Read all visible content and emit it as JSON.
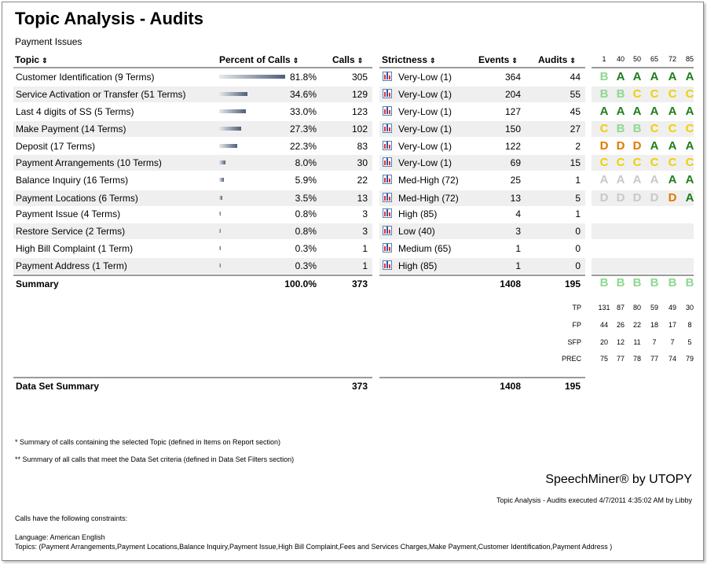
{
  "title": "Topic Analysis - Audits",
  "subtitle": "Payment Issues",
  "headers": {
    "topic": "Topic",
    "percent": "Percent of Calls",
    "calls": "Calls",
    "strictness": "Strictness",
    "events": "Events",
    "audits": "Audits",
    "thresholds": [
      "1",
      "40",
      "50",
      "65",
      "72",
      "85"
    ]
  },
  "rows": [
    {
      "topic": "Customer Identification (9 Terms)",
      "percent": "81.8%",
      "pct": 81.8,
      "calls": "305",
      "strictness": "Very-Low (1)",
      "events": "364",
      "audits": "44",
      "grades": [
        "B",
        "A",
        "A",
        "A",
        "A",
        "A"
      ],
      "gclass": [
        "gB",
        "gA",
        "gA",
        "gA",
        "gA",
        "gA"
      ]
    },
    {
      "topic": "Service Activation or Transfer (51 Terms)",
      "percent": "34.6%",
      "pct": 34.6,
      "calls": "129",
      "strictness": "Very-Low (1)",
      "events": "204",
      "audits": "55",
      "grades": [
        "B",
        "B",
        "C",
        "C",
        "C",
        "C"
      ],
      "gclass": [
        "gB",
        "gB",
        "gC",
        "gC",
        "gC",
        "gC"
      ]
    },
    {
      "topic": "Last 4 digits of SS (5 Terms)",
      "percent": "33.0%",
      "pct": 33.0,
      "calls": "123",
      "strictness": "Very-Low (1)",
      "events": "127",
      "audits": "45",
      "grades": [
        "A",
        "A",
        "A",
        "A",
        "A",
        "A"
      ],
      "gclass": [
        "gA",
        "gA",
        "gA",
        "gA",
        "gA",
        "gA"
      ]
    },
    {
      "topic": "Make Payment (14 Terms)",
      "percent": "27.3%",
      "pct": 27.3,
      "calls": "102",
      "strictness": "Very-Low (1)",
      "events": "150",
      "audits": "27",
      "grades": [
        "C",
        "B",
        "B",
        "C",
        "C",
        "C"
      ],
      "gclass": [
        "gC",
        "gB",
        "gB",
        "gC",
        "gC",
        "gC"
      ]
    },
    {
      "topic": "Deposit (17 Terms)",
      "percent": "22.3%",
      "pct": 22.3,
      "calls": "83",
      "strictness": "Very-Low (1)",
      "events": "122",
      "audits": "2",
      "grades": [
        "D",
        "D",
        "D",
        "A",
        "A",
        "A"
      ],
      "gclass": [
        "gD-orange",
        "gD-orange",
        "gD-orange",
        "gA",
        "gA",
        "gA"
      ]
    },
    {
      "topic": "Payment Arrangements (10 Terms)",
      "percent": "8.0%",
      "pct": 8.0,
      "calls": "30",
      "strictness": "Very-Low (1)",
      "events": "69",
      "audits": "15",
      "grades": [
        "C",
        "C",
        "C",
        "C",
        "C",
        "C"
      ],
      "gclass": [
        "gC",
        "gC",
        "gC",
        "gC",
        "gC",
        "gC"
      ]
    },
    {
      "topic": "Balance Inquiry (16 Terms)",
      "percent": "5.9%",
      "pct": 5.9,
      "calls": "22",
      "strictness": "Med-High (72)",
      "events": "25",
      "audits": "1",
      "grades": [
        "A",
        "A",
        "A",
        "A",
        "A",
        "A"
      ],
      "gclass": [
        "gA-gray",
        "gA-gray",
        "gA-gray",
        "gA-gray",
        "gA",
        "gA"
      ]
    },
    {
      "topic": "Payment Locations (6 Terms)",
      "percent": "3.5%",
      "pct": 3.5,
      "calls": "13",
      "strictness": "Med-High (72)",
      "events": "13",
      "audits": "5",
      "grades": [
        "D",
        "D",
        "D",
        "D",
        "D",
        "A"
      ],
      "gclass": [
        "gD-gray",
        "gD-gray",
        "gD-gray",
        "gD-gray",
        "gD-orange",
        "gA"
      ]
    },
    {
      "topic": "Payment Issue (4 Terms)",
      "percent": "0.8%",
      "pct": 0.8,
      "calls": "3",
      "strictness": "High (85)",
      "events": "4",
      "audits": "1",
      "grades": [],
      "gclass": []
    },
    {
      "topic": "Restore Service (2 Terms)",
      "percent": "0.8%",
      "pct": 0.8,
      "calls": "3",
      "strictness": "Low (40)",
      "events": "3",
      "audits": "0",
      "grades": [],
      "gclass": []
    },
    {
      "topic": "High Bill Complaint (1 Term)",
      "percent": "0.3%",
      "pct": 0.3,
      "calls": "1",
      "strictness": "Medium (65)",
      "events": "1",
      "audits": "0",
      "grades": [],
      "gclass": []
    },
    {
      "topic": "Payment Address (1 Term)",
      "percent": "0.3%",
      "pct": 0.3,
      "calls": "1",
      "strictness": "High (85)",
      "events": "1",
      "audits": "0",
      "grades": [],
      "gclass": []
    }
  ],
  "summary": {
    "label": "Summary",
    "percent": "100.0%",
    "calls": "373",
    "events": "1408",
    "audits": "195",
    "grades": [
      "B",
      "B",
      "B",
      "B",
      "B",
      "B"
    ]
  },
  "stats": [
    {
      "label": "TP",
      "values": [
        "131",
        "87",
        "80",
        "59",
        "49",
        "30"
      ]
    },
    {
      "label": "FP",
      "values": [
        "44",
        "26",
        "22",
        "18",
        "17",
        "8"
      ]
    },
    {
      "label": "SFP",
      "values": [
        "20",
        "12",
        "11",
        "7",
        "7",
        "5"
      ]
    },
    {
      "label": "PREC",
      "values": [
        "75",
        "77",
        "78",
        "77",
        "74",
        "79"
      ]
    }
  ],
  "dataset": {
    "label": "Data Set Summary",
    "calls": "373",
    "events": "1408",
    "audits": "195"
  },
  "notes": {
    "note1": "* Summary of calls containing the selected Topic (defined in Items on Report section)",
    "note2": "** Summary of all calls that meet the Data Set criteria (defined in Data Set Filters section)"
  },
  "brand": "SpeechMiner® by UTOPY",
  "executed": "Topic Analysis - Audits executed 4/7/2011 4:35:02 AM by Libby",
  "constraints": {
    "heading": "Calls have the following constraints:",
    "language": "Language: American English",
    "topics": "Topics: (Payment Arrangements,Payment Locations,Balance Inquiry,Payment Issue,High Bill Complaint,Fees and Services Charges,Make Payment,Customer Identification,Payment Address )"
  },
  "colors": {
    "gradeA": "#1e7d1e",
    "gradeB": "#8fd88f",
    "gradeC": "#f0d000",
    "gradeD": "#e07800",
    "gradeMuted": "#c8c8c8",
    "rowBand": "#efefef"
  },
  "icons": {
    "sort": "up-down-arrows-icon",
    "strictness": "bar-chart-icon"
  }
}
